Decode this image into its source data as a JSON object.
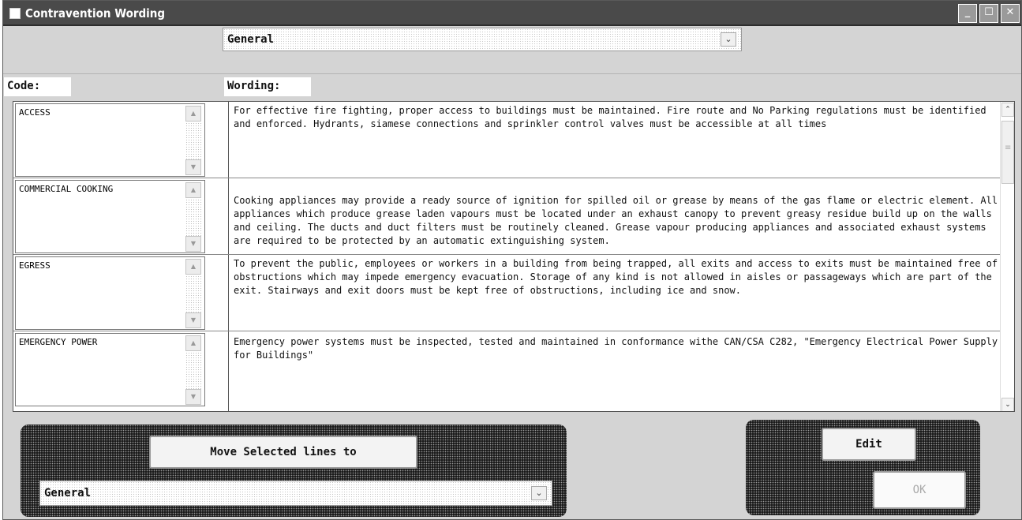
{
  "window": {
    "title": "Contravention Wording",
    "controls": {
      "minimize": "_",
      "maximize": "☐",
      "close": "✕"
    }
  },
  "category_select": {
    "value": "General",
    "arrow": "⌄"
  },
  "headers": {
    "code": "Code:",
    "wording": "Wording:"
  },
  "rows": [
    {
      "code": "ACCESS",
      "wording": "For effective fire fighting, proper access to buildings must be maintained. Fire route and No Parking regulations must be identified and enforced. Hydrants, siamese connections and sprinkler control valves must be accessible at all times"
    },
    {
      "code": "COMMERCIAL COOKING",
      "wording": "Cooking appliances may provide a ready source of ignition for spilled oil or grease by means of the gas flame or electric element. All appliances which produce grease laden vapours must be located under an exhaust canopy to prevent greasy residue build up on the walls and ceiling. The ducts and duct filters must be routinely cleaned. Grease vapour producing appliances and associated exhaust systems are required to be protected by an automatic extinguishing system."
    },
    {
      "code": "EGRESS",
      "wording": "To prevent the public, employees or workers in a building from being trapped, all exits and access to exits must be maintained free of obstructions which may impede emergency evacuation. Storage of any kind is not allowed in aisles or passageways which are part of the exit. Stairways and exit doors must be kept free of obstructions, including ice and snow."
    },
    {
      "code": "EMERGENCY POWER",
      "wording": "Emergency power systems must be inspected, tested and maintained in conformance withe CAN/CSA C282, \"Emergency Electrical Power Supply for Buildings\""
    }
  ],
  "icons": {
    "scroll_up": "▲",
    "scroll_down": "▼",
    "main_up": "⌃",
    "main_down": "⌄",
    "grip": "≡"
  },
  "move_panel": {
    "button_label": "Move Selected lines to",
    "select_value": "General",
    "arrow": "⌄"
  },
  "action_panel": {
    "edit_label": "Edit",
    "ok_label": "OK"
  }
}
